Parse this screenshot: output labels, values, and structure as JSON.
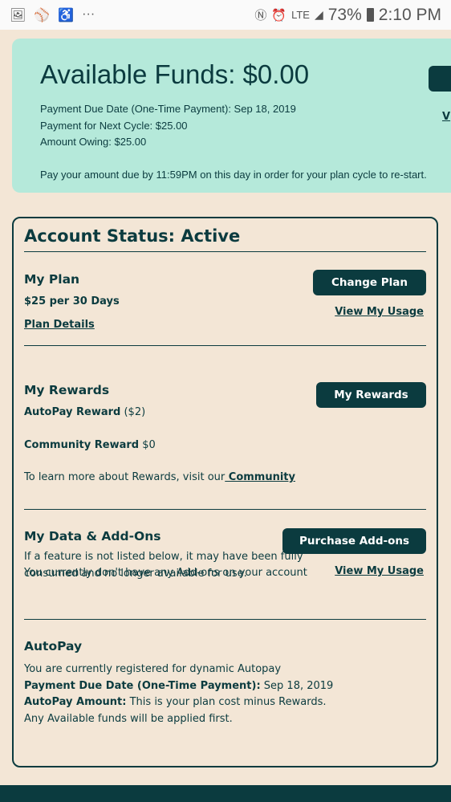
{
  "status_bar": {
    "left_icons": [
      "gallery-icon",
      "ball-icon",
      "accessibility-icon",
      "more-icon"
    ],
    "battery": "73%",
    "time": "2:10 PM"
  },
  "funds": {
    "title": "Available Funds: $0.00",
    "due_date": "Payment Due Date (One-Time Payment): Sep 18, 2019",
    "next_cycle": "Payment for Next Cycle: $25.00",
    "owing": "Amount Owing: $25.00",
    "note": "Pay your amount due by 11:59PM on this day in order for your plan cycle to re-start.",
    "link_partial": "V"
  },
  "account": {
    "title": "Account Status: Active",
    "plan": {
      "heading": "My Plan",
      "price": "$25 per 30 Days",
      "details_link": "Plan Details",
      "change_button": "Change Plan",
      "usage_link": "View My Usage"
    },
    "rewards": {
      "heading": "My Rewards",
      "button": "My Rewards",
      "autopay_label": "AutoPay Reward",
      "autopay_value": " ($2)",
      "community_label": "Community Reward",
      "community_value": " $0",
      "learn_text": "To learn more about Rewards, visit our",
      "community_link": " Community"
    },
    "addons": {
      "heading": "My Data & Add-Ons",
      "button": "Purchase Add-ons",
      "usage_link": "View My Usage",
      "line1": "If a feature is not listed below, it may have been fully",
      "line2": "consumed and no longer available for use.",
      "none": "You currently don't have any Add-ons on your account"
    },
    "autopay": {
      "heading": "AutoPay",
      "registered": "You are currently registered for dynamic Autopay",
      "due_label": "Payment Due Date (One-Time Payment):",
      "due_value": " Sep 18, 2019",
      "amount_label": "AutoPay Amount:",
      "amount_value": " This is your plan cost minus Rewards.",
      "funds_note": "Any Available funds will be applied first."
    }
  }
}
